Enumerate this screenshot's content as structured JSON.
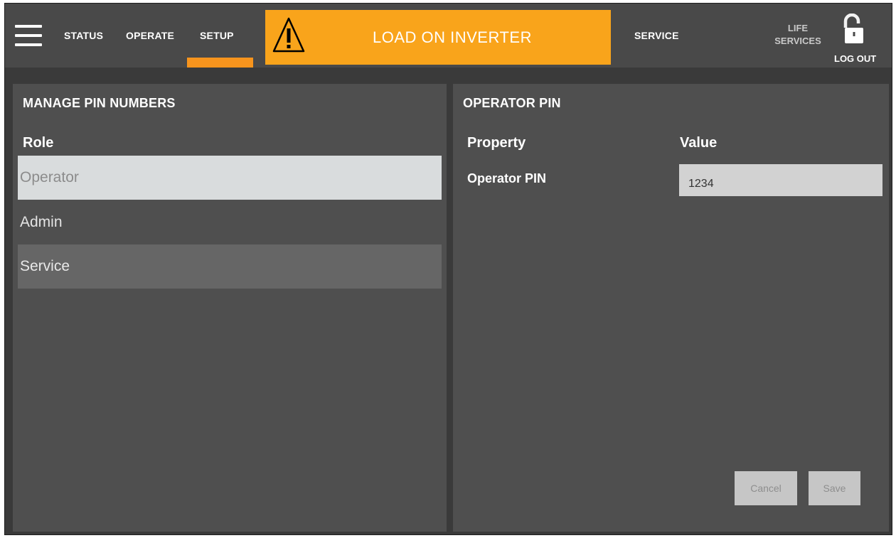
{
  "header": {
    "menu_icon": "hamburger-menu-icon",
    "nav": [
      {
        "label": "STATUS",
        "active": false
      },
      {
        "label": "OPERATE",
        "active": false
      },
      {
        "label": "SETUP",
        "active": true
      }
    ],
    "alarm": {
      "text": "LOAD ON INVERTER",
      "icon": "warning-triangle-icon",
      "color": "#f9a41b"
    },
    "service_label": "SERVICE",
    "life_services_lines": [
      "LIFE",
      "SERVICES"
    ],
    "logout_label": "LOG OUT",
    "logout_icon": "unlocked-padlock-icon",
    "accent_color": "#f7941d"
  },
  "left_panel": {
    "title": "MANAGE PIN NUMBERS",
    "column_header": "Role",
    "roles": [
      {
        "label": "Operator",
        "state": "selected"
      },
      {
        "label": "Admin",
        "state": "normal"
      },
      {
        "label": "Service",
        "state": "highlighted"
      }
    ]
  },
  "right_panel": {
    "title": "OPERATOR PIN",
    "columns": {
      "property": "Property",
      "value": "Value"
    },
    "rows": [
      {
        "property": "Operator PIN",
        "value": "1234"
      }
    ],
    "buttons": {
      "cancel": "Cancel",
      "save": "Save"
    }
  }
}
